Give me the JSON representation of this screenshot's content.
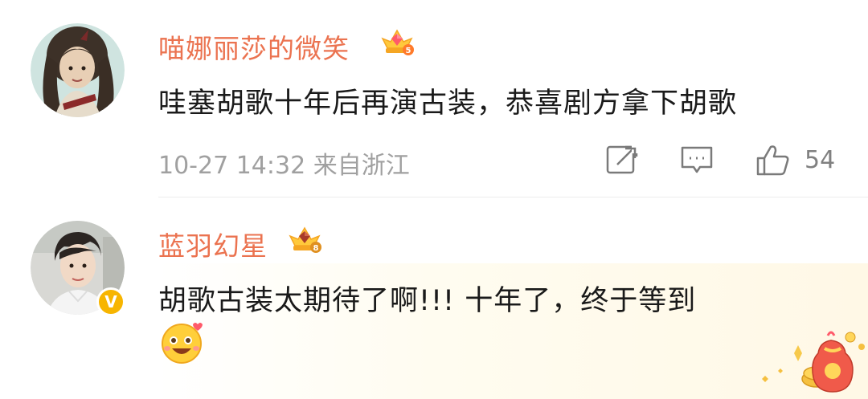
{
  "comments": [
    {
      "username": "喵娜丽莎的微笑",
      "badge_icon": "crown-badge-5",
      "text": "哇塞胡歌十年后再演古装，恭喜剧方拿下胡歌",
      "meta": "10-27 14:32  来自浙江",
      "likes": "54"
    },
    {
      "username": "蓝羽幻星",
      "badge_icon": "crown-badge-8",
      "verified": "V",
      "text": "胡歌古装太期待了啊!!! 十年了，终于等到",
      "emoji_icon": "excited-face-emoji"
    }
  ],
  "colors": {
    "username": "#eb7350",
    "text": "#1a1a1a",
    "meta": "#a0a0a0",
    "verified": "#f7b500"
  }
}
